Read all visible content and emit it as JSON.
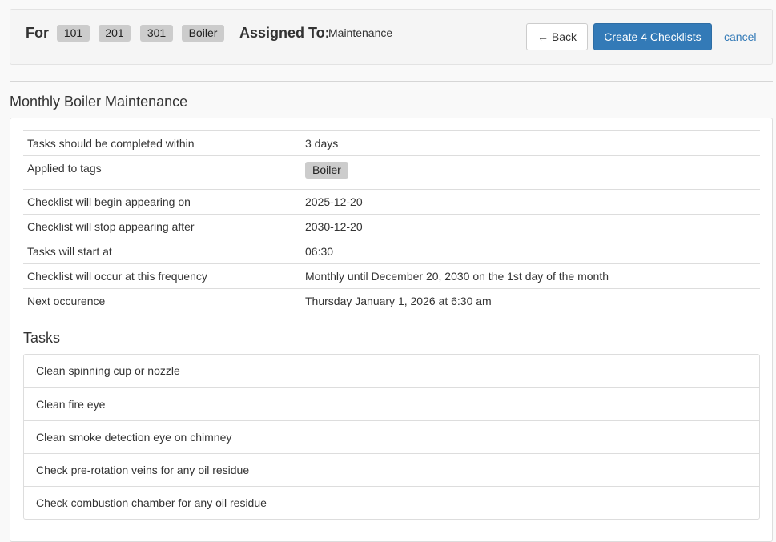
{
  "header": {
    "for_label": "For",
    "tags": [
      "101",
      "201",
      "301",
      "Boiler"
    ],
    "assigned_label": "Assigned To:",
    "assigned_value": "Maintenance",
    "back_label": "← Back",
    "create_label": "Create 4 Checklists",
    "cancel_label": "cancel"
  },
  "checklist": {
    "title": "Monthly Boiler Maintenance",
    "details": [
      {
        "label": "Tasks should be completed within",
        "value": "3 days"
      },
      {
        "label": "Applied to tags",
        "value": "Boiler"
      },
      {
        "label": "Checklist will begin appearing on",
        "value": "2025-12-20"
      },
      {
        "label": "Checklist will stop appearing after",
        "value": "2030-12-20"
      },
      {
        "label": "Tasks will start at",
        "value": "06:30"
      },
      {
        "label": "Checklist will occur at this frequency",
        "value": "Monthly until December 20, 2030 on the 1st day of the month"
      },
      {
        "label": "Next occurence",
        "value": "Thursday January 1, 2026 at 6:30 am"
      }
    ],
    "tasks_title": "Tasks",
    "tasks": [
      "Clean spinning cup or nozzle",
      "Clean fire eye",
      "Clean smoke detection eye on chimney",
      "Check pre-rotation veins for any oil residue",
      "Check combustion chamber for any oil residue"
    ]
  },
  "colors": {
    "primary": "#337ab7",
    "tag_bg": "#cccccc"
  }
}
